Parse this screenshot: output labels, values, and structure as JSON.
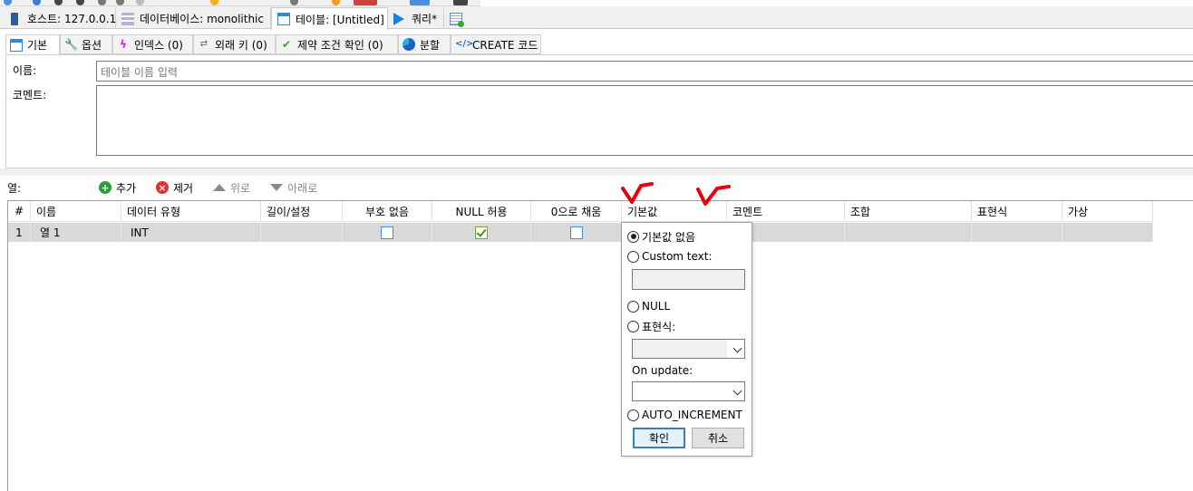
{
  "doc_tabs": [
    {
      "label": "호스트: 127.0.0.1",
      "icon": "server-icon"
    },
    {
      "label": "데이터베이스: monolithic",
      "icon": "database-icon"
    },
    {
      "label": "테이블: [Untitled]",
      "icon": "table-icon"
    },
    {
      "label": "쿼리*",
      "icon": "play-icon"
    }
  ],
  "new_tab_icon": "new-query-tab-icon",
  "sub_tabs": [
    {
      "label": "기본",
      "icon": "table-icon"
    },
    {
      "label": "옵션",
      "icon": "wrench-icon"
    },
    {
      "label": "인덱스 (0)",
      "icon": "lightning-icon"
    },
    {
      "label": "외래 키 (0)",
      "icon": "foreign-key-icon"
    },
    {
      "label": "제약 조건 확인 (0)",
      "icon": "check-icon"
    },
    {
      "label": "분할",
      "icon": "partition-icon"
    },
    {
      "label": "CREATE 코드",
      "icon": "code-icon"
    }
  ],
  "form": {
    "name_label": "이름:",
    "name_placeholder": "테이블 이름 입력",
    "comment_label": "코멘트:"
  },
  "columns_toolbar": {
    "label": "열:",
    "add": "추가",
    "remove": "제거",
    "up": "위로",
    "down": "아래로"
  },
  "grid": {
    "headers": [
      "#",
      "이름",
      "데이터 유형",
      "길이/설정",
      "부호 없음",
      "NULL 허용",
      "0으로 채움",
      "기본값",
      "코멘트",
      "조합",
      "표현식",
      "가상"
    ],
    "rows": [
      {
        "num": "1",
        "name": "열 1",
        "type": "INT",
        "length": "",
        "unsigned": false,
        "allow_null": true,
        "zerofill": false
      }
    ]
  },
  "default_popup": {
    "options": [
      "기본값 없음",
      "Custom text:",
      "NULL",
      "표현식:",
      "AUTO_INCREMENT"
    ],
    "selected": "기본값 없음",
    "custom_text_value": "",
    "expression_value": "",
    "on_update_label": "On update:",
    "on_update_value": "",
    "ok": "확인",
    "cancel": "취소"
  },
  "colors": {
    "accent": "#3c7fb1",
    "mark_red": "#e8000b",
    "row_selected": "#d9d9d9",
    "add_green": "#2e9b3a",
    "remove_red": "#e03030"
  }
}
